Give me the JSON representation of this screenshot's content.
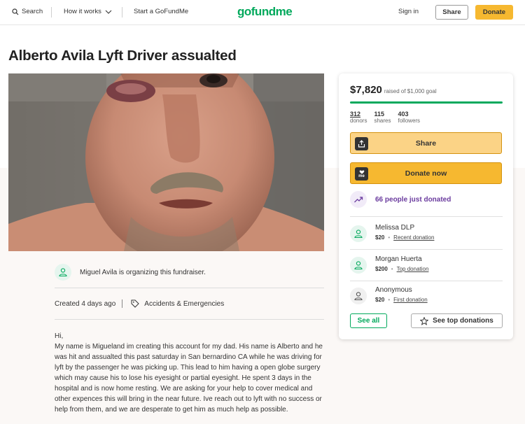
{
  "header": {
    "search_label": "Search",
    "how_it_works_label": "How it works",
    "start_label": "Start a GoFundMe",
    "logo_text": "gofundme",
    "sign_in_label": "Sign in",
    "share_label": "Share",
    "donate_label": "Donate"
  },
  "campaign": {
    "title": "Alberto Avila Lyft Driver assualted",
    "organizer_text": "Miguel Avila is organizing this fundraiser.",
    "created_text": "Created 4 days ago",
    "category": "Accidents & Emergencies",
    "description": "Hi,\nMy name is Migueland im creating this account for my dad. His name is Alberto and he was hit and assualted this past saturday in San bernardino CA while he was driving for lyft by the passenger he was picking up. This lead to him having a open globe surgery which may cause his to lose his eyesight or partial eyesight. He spent 3 days in the hospital and is now home resting. We are asking for your help to cover medical and other expences this will bring in the near future. Ive reach out to lyft with no success or help from them, and we are desperate to get him as much help as possible."
  },
  "card": {
    "amount_raised": "$7,820",
    "goal_text": "raised of $1,000 goal",
    "progress_fraction": 1.0,
    "stats": [
      {
        "value": "312",
        "label": "donors"
      },
      {
        "value": "115",
        "label": "shares"
      },
      {
        "value": "403",
        "label": "followers"
      }
    ],
    "share_label": "Share",
    "donate_now_label": "Donate now",
    "donate_icon_text": "me",
    "recent_count_text": "66 people just donated",
    "donations": [
      {
        "name": "Melissa DLP",
        "amount": "$20",
        "tag": "Recent donation"
      },
      {
        "name": "Morgan Huerta",
        "amount": "$200",
        "tag": "Top donation"
      },
      {
        "name": "Anonymous",
        "amount": "$20",
        "tag": "First donation"
      }
    ],
    "see_all_label": "See all",
    "see_top_label": "See top donations"
  },
  "colors": {
    "brand_green": "#02a95c",
    "donate_yellow": "#f6b830",
    "trend_purple": "#6a3b9e"
  }
}
